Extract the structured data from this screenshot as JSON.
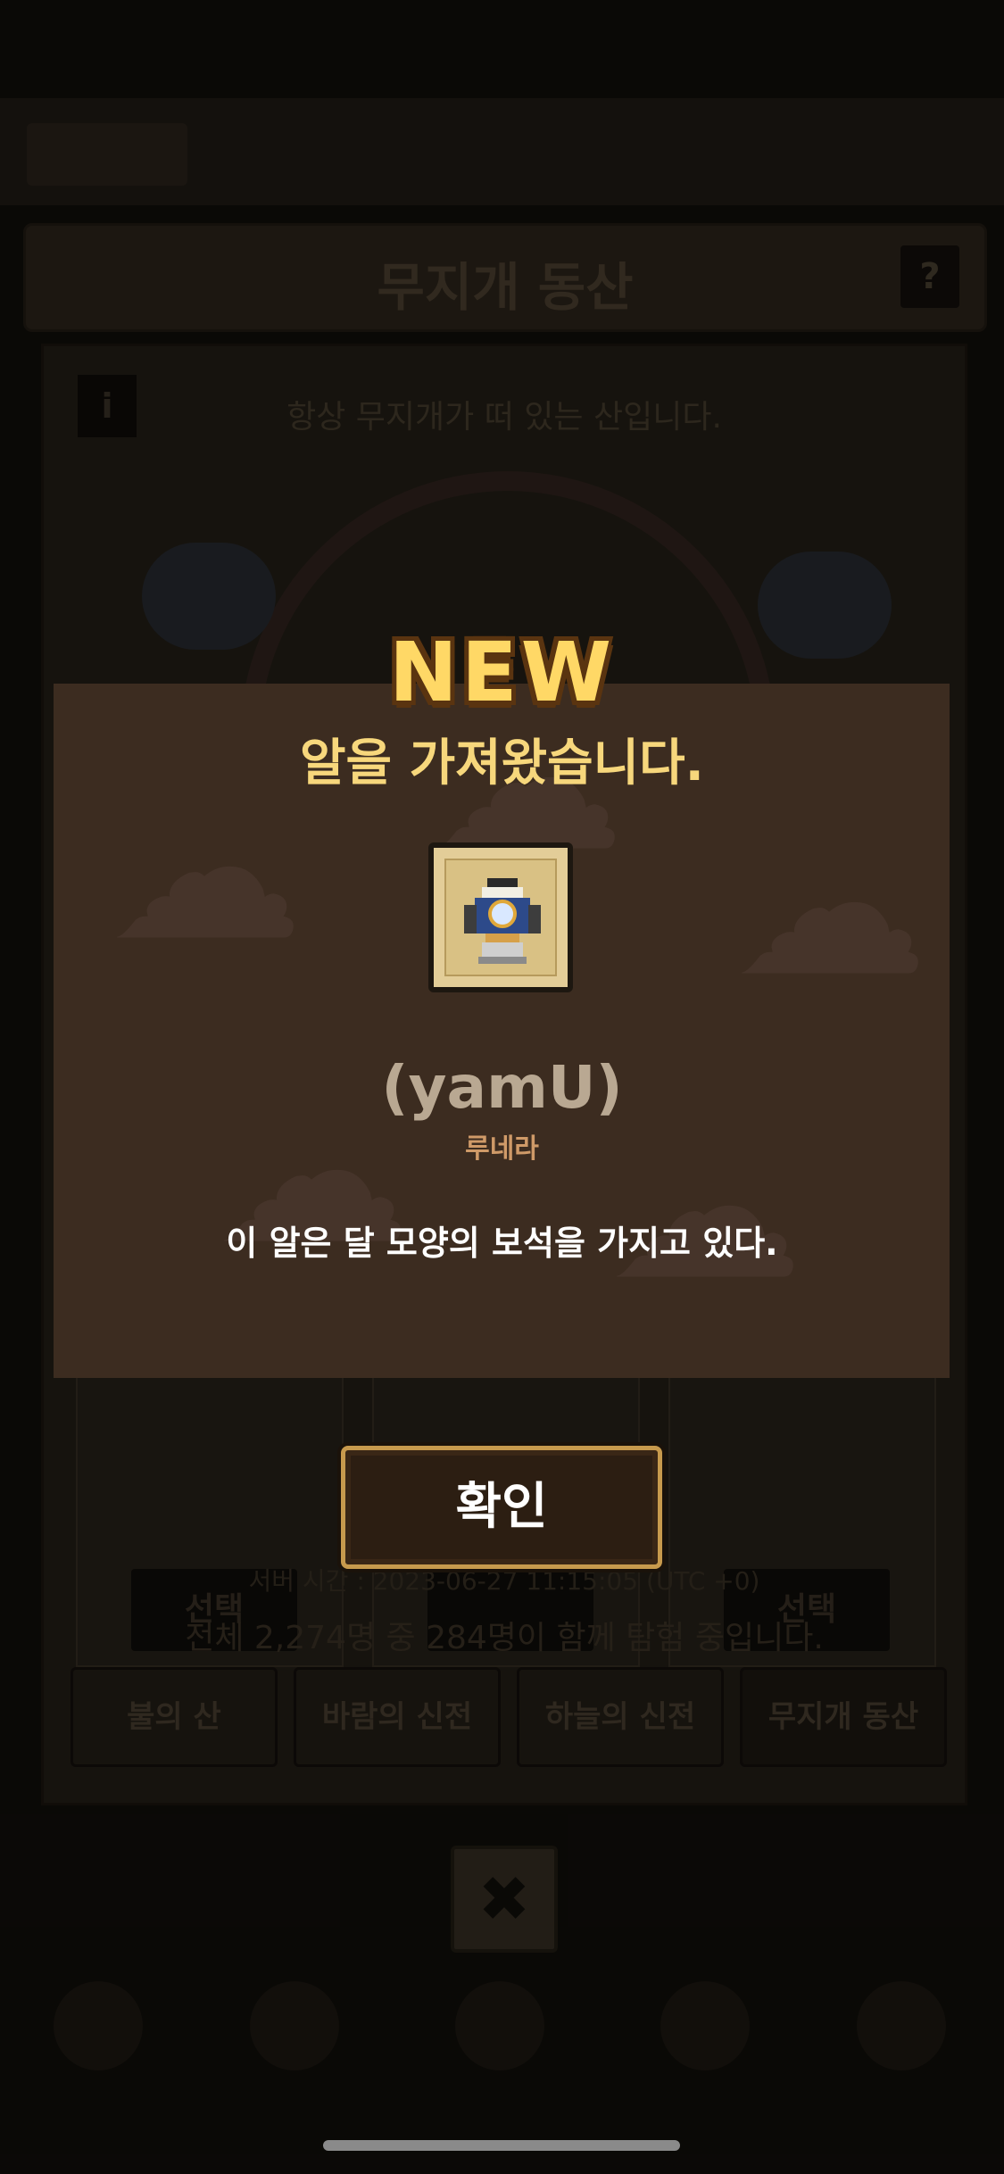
{
  "background": {
    "header_title": "무지개 동산",
    "help_label": "?",
    "info_label": "i",
    "description": "항상 무지개가 떠 있는 산입니다.",
    "slots": [
      {
        "button_label": "선택"
      },
      {
        "button_label": ""
      },
      {
        "button_label": "선택"
      }
    ],
    "server_time": "서버 시간 : 2023-06-27 11:15:05 (UTC +0)",
    "explorers": "전체 2,274명 중 284명이 함께 탐험 중입니다.",
    "tabs": [
      {
        "label": "불의 산"
      },
      {
        "label": "바람의 신전"
      },
      {
        "label": "하늘의 신전"
      },
      {
        "label": "무지개 동산",
        "active": true
      }
    ],
    "close_label": "✖"
  },
  "dialog": {
    "badge": "NEW",
    "headline": "알을 가져왔습니다.",
    "egg_name": "(yamU)",
    "egg_subtitle": "루네라",
    "egg_description": "이 알은 달 모양의 보석을 가지고 있다.",
    "confirm_label": "확인",
    "egg_icon": "egg-icon"
  },
  "colors": {
    "panel": "#3c2c20",
    "headline": "#f7d77c",
    "badge": "#ffd866",
    "button_border": "#c79a4d"
  }
}
